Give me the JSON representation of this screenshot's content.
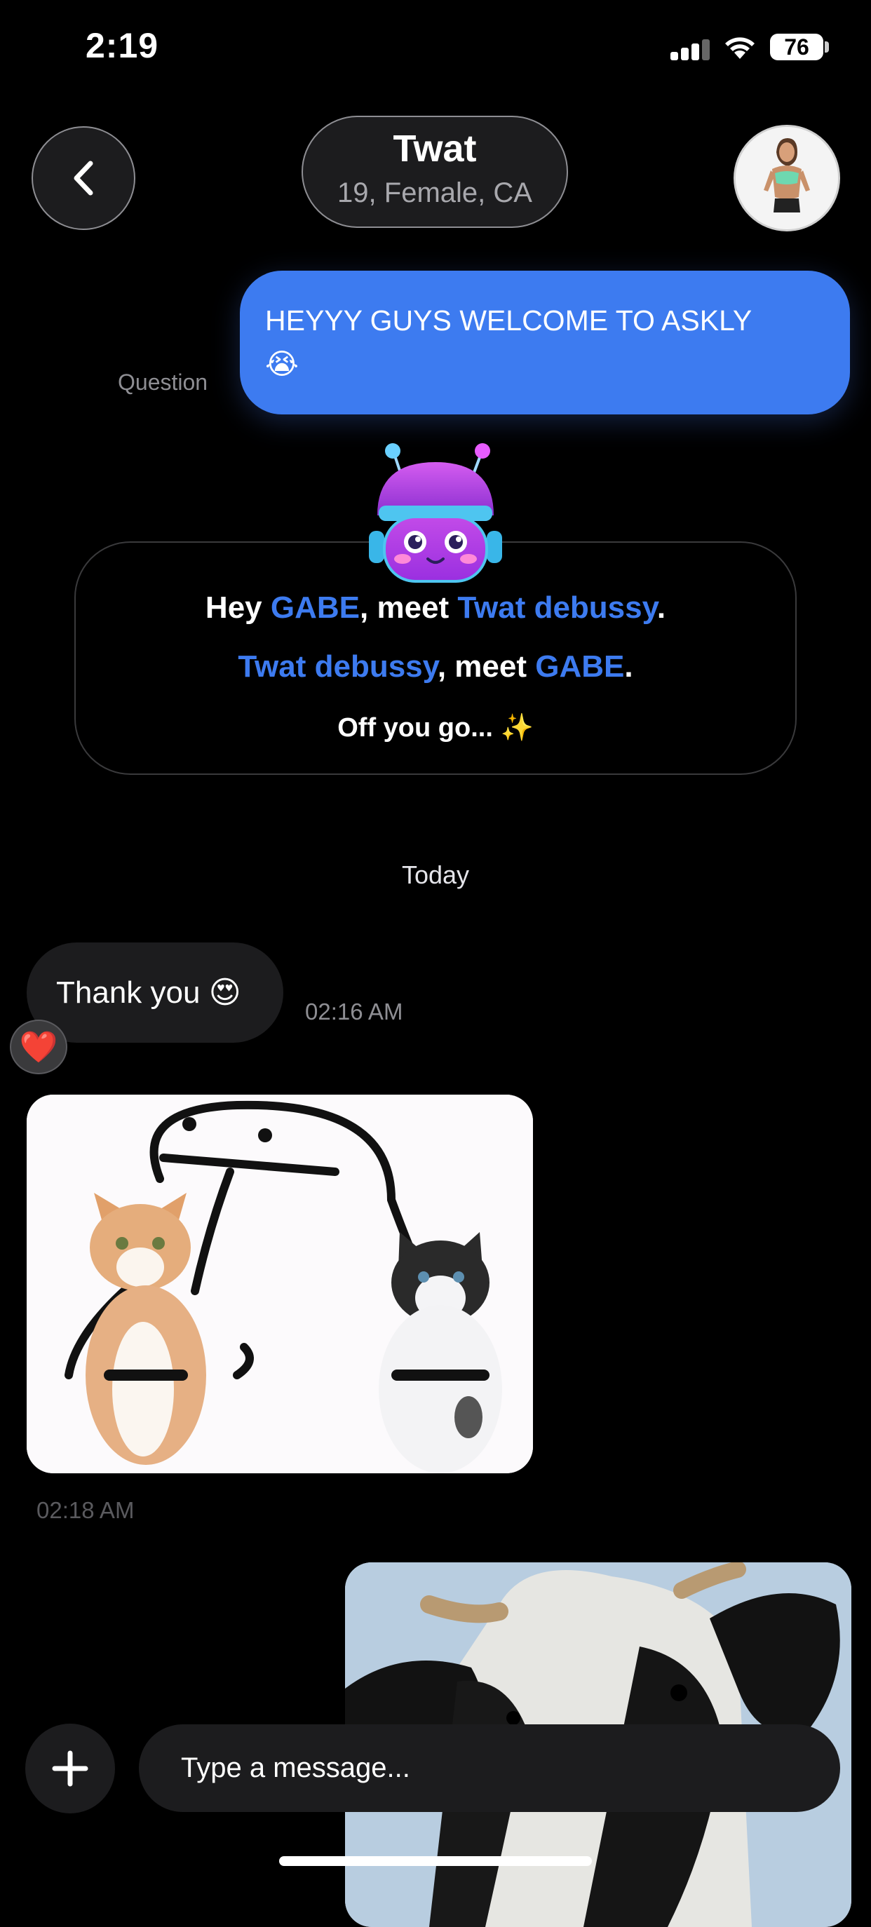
{
  "status_bar": {
    "time": "2:19",
    "battery": "76"
  },
  "header": {
    "name": "Twat",
    "subtitle": "19, Female, CA"
  },
  "question": {
    "label": "Question",
    "text": "HEYYY GUYS WELCOME TO ASKLY",
    "emoji": "😭"
  },
  "intro": {
    "line1": {
      "a": "Hey ",
      "user": "GABE",
      "b": ", meet ",
      "match": "Twat debussy",
      "c": "."
    },
    "line2": {
      "match": "Twat debussy",
      "b": ", meet ",
      "user": "GABE",
      "c": "."
    },
    "line3": {
      "text": "Off you go...",
      "emoji": "✨"
    }
  },
  "date_divider": "Today",
  "messages": [
    {
      "text": "Thank you",
      "emoji": "😍",
      "time": "02:16 AM",
      "reaction": "❤️"
    },
    {
      "type": "image",
      "time": "02:18 AM"
    },
    {
      "type": "image"
    }
  ],
  "composer": {
    "placeholder": "Type a message..."
  },
  "colors": {
    "accent": "#3d7bf0",
    "bubble": "#1c1c1e",
    "background": "#000000"
  },
  "icons": {
    "back": "chevron-left-icon",
    "add": "plus-icon"
  }
}
